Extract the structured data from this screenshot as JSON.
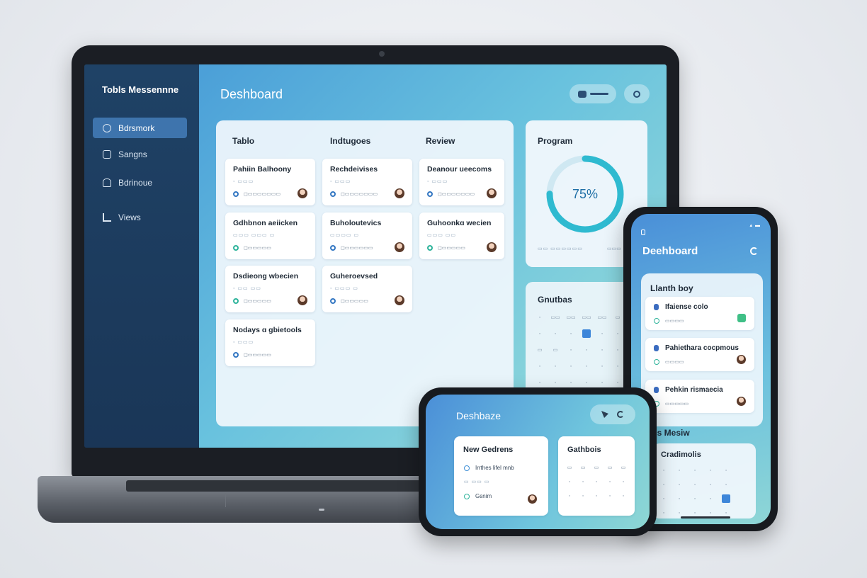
{
  "laptop": {
    "app_name": "Tobls Messennne",
    "nav": [
      {
        "label": "Bdrsmork",
        "icon": "dashboard-icon"
      },
      {
        "label": "Sangns",
        "icon": "settings-icon"
      },
      {
        "label": "Bdrinoue",
        "icon": "lock-icon"
      },
      {
        "label": "Views",
        "icon": "views-icon"
      }
    ],
    "title": "Deshboard",
    "board": {
      "columns": [
        {
          "heading": "Tablo",
          "cards": [
            {
              "title": "Pahiin Balhoony",
              "meta": "◦ ▭▭▭",
              "status": "◻▭▭▭▭▭▭▭"
            },
            {
              "title": "Gdhbnon aeiicken",
              "meta": "▭▭▭ ▭▭▭ ▭",
              "status": "◻▭▭▭▭▭"
            },
            {
              "title": "Dsdieong wbecien",
              "meta": "◦ ▭▭ ▭▭",
              "status": "◻▭▭▭▭▭"
            },
            {
              "title": "Nodays ɑ gbietools",
              "meta": "◦ ▭▭▭",
              "status": "◻▭▭▭▭▭"
            }
          ]
        },
        {
          "heading": "Indtugoes",
          "cards": [
            {
              "title": "Rechdeivises",
              "meta": "◦ ▭▭▭",
              "status": "◻▭▭▭▭▭▭▭"
            },
            {
              "title": "Buholoutevics",
              "meta": "▭▭▭▭ ▭",
              "status": "◻▭▭▭▭▭▭"
            },
            {
              "title": "Guheroevsed",
              "meta": "◦ ▭▭▭ ▭",
              "status": "◻▭▭▭▭▭"
            }
          ]
        },
        {
          "heading": "Review",
          "cards": [
            {
              "title": "Deanour ueecoms",
              "meta": "◦ ▭▭▭",
              "status": "◻▭▭▭▭▭▭▭"
            },
            {
              "title": "Guhoonkɑ wecien",
              "meta": "▭▭▭ ▭▭",
              "status": "◻▭▭▭▭▭"
            }
          ]
        }
      ]
    },
    "progress": {
      "title": "Program",
      "value": 75,
      "label": "75%",
      "foot_left": "▭▭ ▭▭▭▭▭▭",
      "foot_right": "▭▭▭"
    },
    "calendar": {
      "title": "Gnutbas",
      "cells": [
        "◦",
        "▭▭",
        "▭▭",
        "▭▭",
        "▭▭",
        "▭",
        "◦",
        "◦",
        "◦",
        "■",
        "◦",
        "◦",
        "▭",
        "▭",
        "◦",
        "◦",
        "◦",
        "◦",
        "◦",
        "◦",
        "◦",
        "◦",
        "◦",
        "◦",
        "◦",
        "◦",
        "◦",
        "◦",
        "◦",
        "◦"
      ],
      "highlight_index": 9,
      "accent": "#3d86d9"
    }
  },
  "phone_tall": {
    "title": "Deehboard",
    "panel_title": "Llanth boy",
    "cards": [
      {
        "title": "Ifaiense colo",
        "sub": "▭▭▭▭",
        "trailing": "check"
      },
      {
        "title": "Pahiethara cocpmous",
        "sub": "▭▭▭▭",
        "trailing": "avatar"
      },
      {
        "title": "Pehkin rismaecia",
        "sub": "▭▭▭▭▭",
        "trailing": "avatar"
      }
    ],
    "section": "cs Mesiw",
    "calendar": {
      "title": "Cradimolis",
      "cells": [
        "◦",
        "◦",
        "◦",
        "◦",
        "◦",
        "◦",
        "◦",
        "◦",
        "◦",
        "◦",
        "◦",
        "◦",
        "◦",
        "◦",
        "■",
        "◦",
        "◦",
        "◦",
        "◦",
        "◦"
      ],
      "highlight_index": 14
    }
  },
  "phone_wide": {
    "title": "Deshbaze",
    "card1": {
      "title": "New Gedrens",
      "row1": "Irrthes lifel mnb",
      "row2": "▭ ▭▭ ▭",
      "row3": "Gsnim"
    },
    "card2": {
      "title": "Gathbois",
      "cells": [
        "▭",
        "▭",
        "▭",
        "▭",
        "▭",
        "◦",
        "◦",
        "◦",
        "◦",
        "◦",
        "◦",
        "◦",
        "◦",
        "◦",
        "◦"
      ]
    }
  },
  "colors": {
    "sidebar": "#1f4266",
    "accent": "#3e74ad",
    "progress_ring": "#2fbad0",
    "status_green": "#2db39a"
  }
}
